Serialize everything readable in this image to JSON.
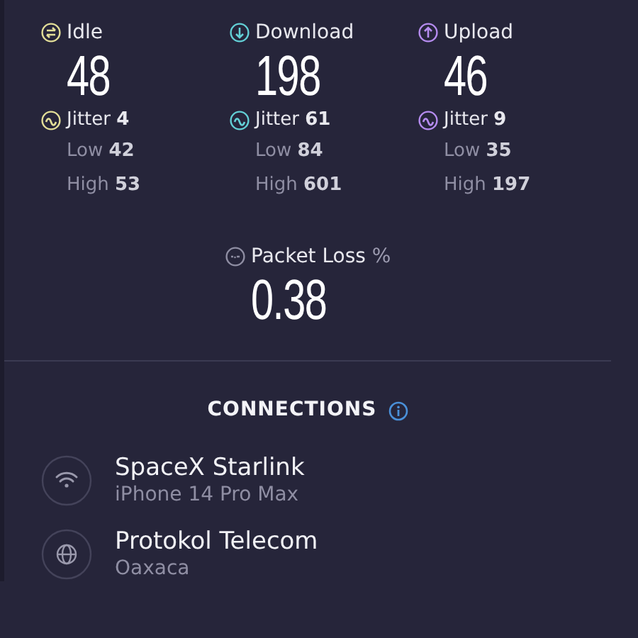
{
  "metrics": [
    {
      "kind": "idle",
      "label": "Idle",
      "color": "#e3df98",
      "value": "48",
      "jitter_label": "Jitter",
      "jitter": "4",
      "low_label": "Low",
      "low": "42",
      "high_label": "High",
      "high": "53"
    },
    {
      "kind": "download",
      "label": "Download",
      "color": "#63d0d6",
      "value": "198",
      "jitter_label": "Jitter",
      "jitter": "61",
      "low_label": "Low",
      "low": "84",
      "high_label": "High",
      "high": "601"
    },
    {
      "kind": "upload",
      "label": "Upload",
      "color": "#b68cf0",
      "value": "46",
      "jitter_label": "Jitter",
      "jitter": "9",
      "low_label": "Low",
      "low": "35",
      "high_label": "High",
      "high": "197"
    }
  ],
  "packet_loss": {
    "label": "Packet Loss",
    "unit": "%",
    "value": "0.38"
  },
  "connections": {
    "title": "CONNECTIONS",
    "items": [
      {
        "kind": "wifi",
        "name": "SpaceX Starlink",
        "detail": "iPhone 14 Pro Max"
      },
      {
        "kind": "globe",
        "name": "Protokol Telecom",
        "detail": "Oaxaca"
      }
    ]
  }
}
